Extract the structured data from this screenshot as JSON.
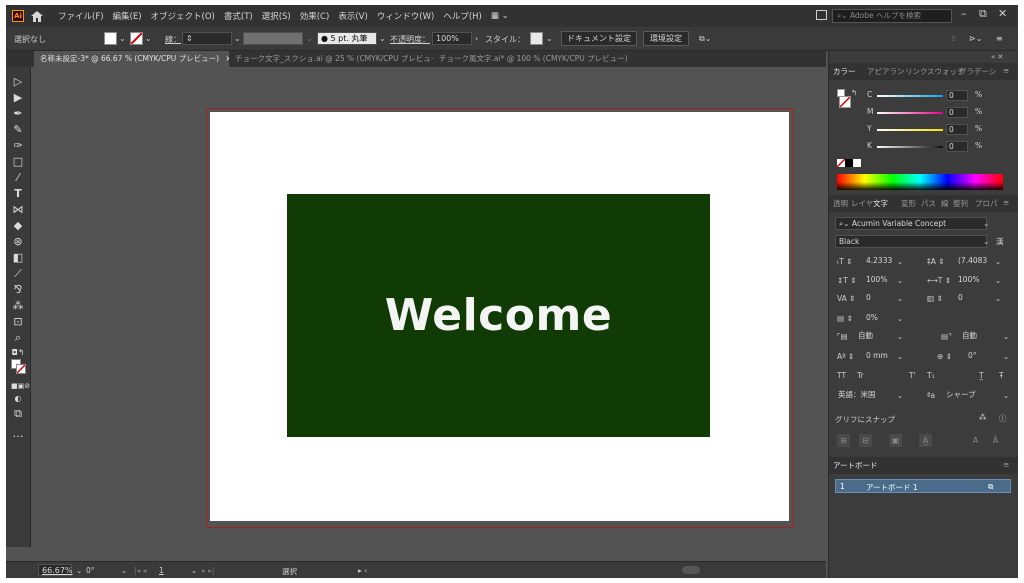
{
  "app": {
    "logo_text": "Ai",
    "menu": [
      "ファイル(F)",
      "編集(E)",
      "オブジェクト(O)",
      "書式(T)",
      "選択(S)",
      "効果(C)",
      "表示(V)",
      "ウィンドウ(W)",
      "ヘルプ(H)"
    ],
    "search_placeholder": "Adobe ヘルプを検索"
  },
  "control_bar": {
    "selection_label": "選択なし",
    "stroke_label": "線：",
    "brush_label": "5 pt. 丸筆",
    "opacity_label": "不透明度：",
    "opacity_value": "100%",
    "style_label": "スタイル：",
    "doc_setup_button": "ドキュメント設定",
    "preferences_button": "環境設定"
  },
  "tabs": [
    {
      "label": "名称未設定-3* @ 66.67 % (CMYK/CPU プレビュー)",
      "close": "×",
      "active": true
    },
    {
      "label": "チョーク文字_スクショ.ai @ 25 % (CMYK/CPU プレビュー)",
      "close": "×",
      "active": false
    },
    {
      "label": "チョーク風文字.ai* @ 100 % (CMYK/CPU プレビュー)",
      "close": "×",
      "active": false
    }
  ],
  "artboard": {
    "text": "Welcome",
    "rect_color": "#113b04"
  },
  "status_bar": {
    "zoom": "66.67%",
    "rotation": "0°",
    "artboard_number": "1",
    "mode": "選択"
  },
  "color_panel": {
    "tabs": [
      "カラー",
      "アピアラン",
      "リンク",
      "スウォッチ",
      "グラデーシ"
    ],
    "channels": [
      {
        "name": "C",
        "value": "0",
        "unit": "%",
        "color": "#00a8e8"
      },
      {
        "name": "M",
        "value": "0",
        "unit": "%",
        "color": "#e8008a"
      },
      {
        "name": "Y",
        "value": "0",
        "unit": "%",
        "color": "#f0e000"
      },
      {
        "name": "K",
        "value": "0",
        "unit": "%",
        "color": "#111111"
      }
    ]
  },
  "character_panel": {
    "tabs": [
      "透明",
      "レイヤ",
      "文字",
      "変形",
      "パス",
      "線",
      "整列",
      "プロパ"
    ],
    "font_family": "Acumin Variable Concept",
    "font_style": "Black",
    "font_size": "4.2333",
    "leading": "(7.4083",
    "vertical_scale": "100%",
    "horizontal_scale": "100%",
    "kerning": "0",
    "tracking": "0",
    "tsume": "0%",
    "aki_left": "自動",
    "aki_right": "自動",
    "baseline_shift": "0 mm",
    "rotation": "0°",
    "language": "英語：米国",
    "anti_alias": "シャープ",
    "snap_label": "グリフにスナップ"
  },
  "artboards_panel": {
    "title": "アートボード",
    "rows": [
      {
        "number": "1",
        "name": "アートボード 1"
      }
    ]
  }
}
